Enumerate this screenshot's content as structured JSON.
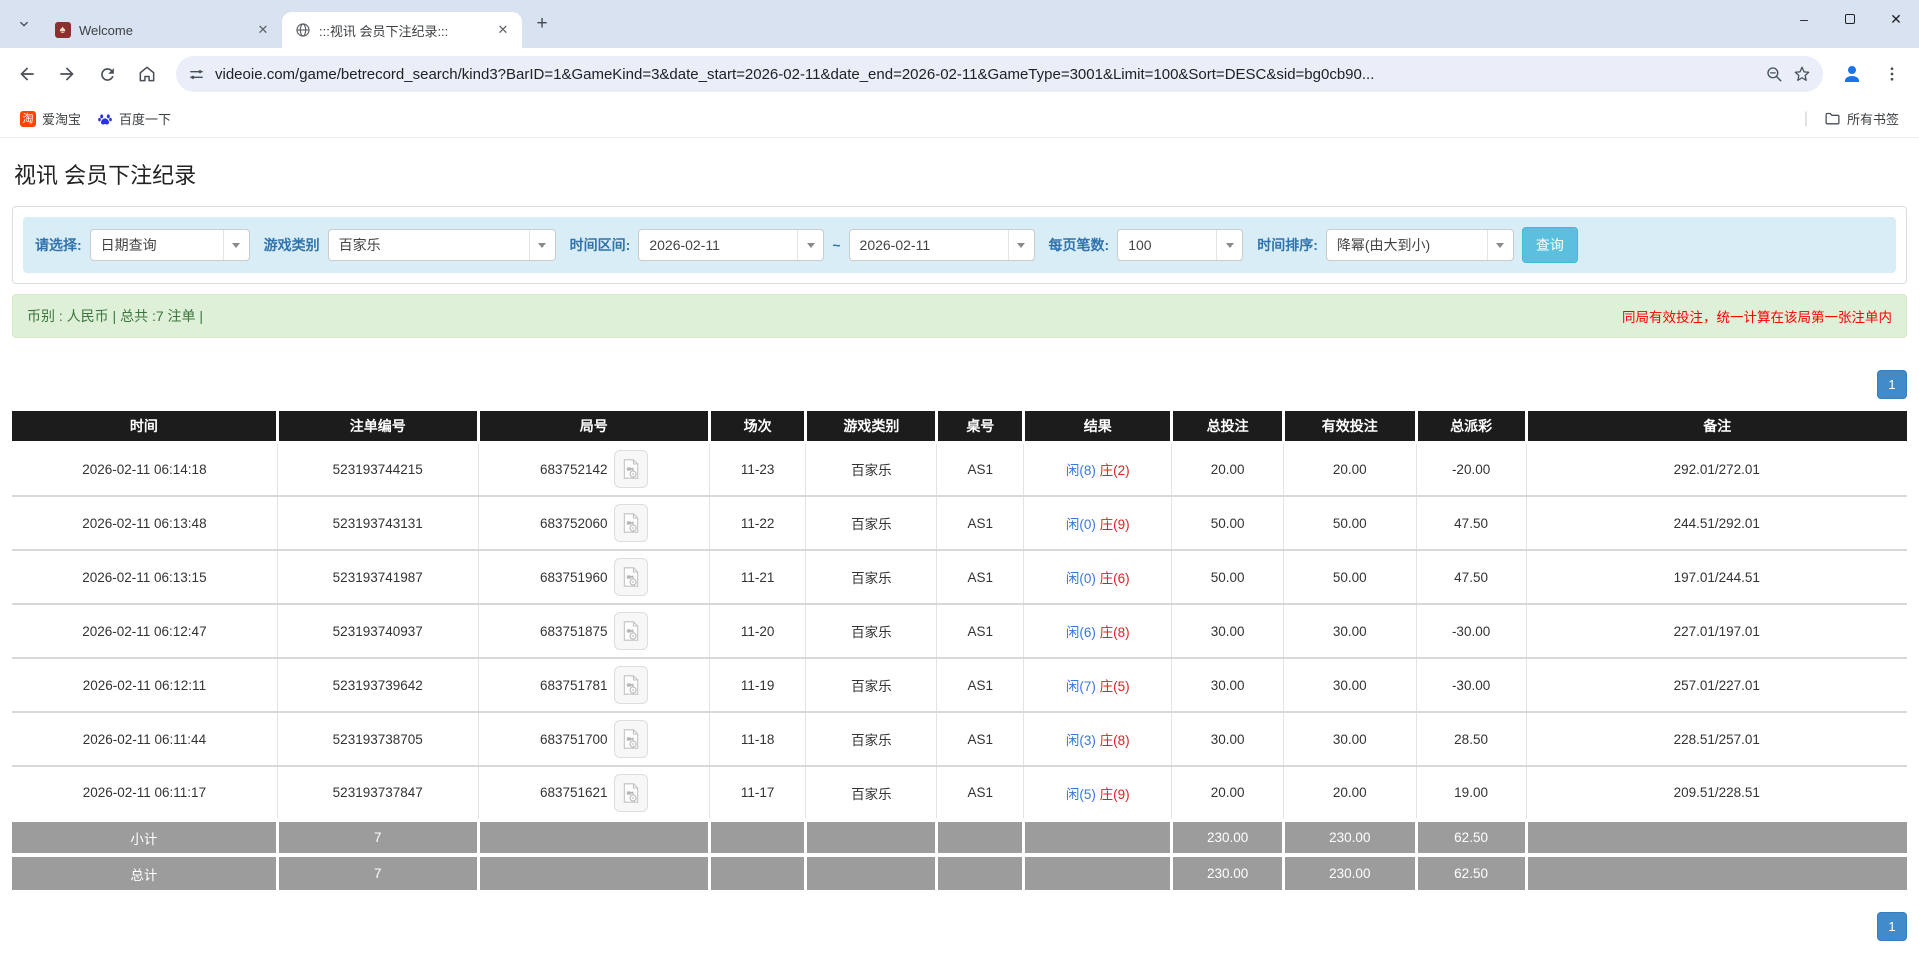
{
  "browser": {
    "tabs": [
      {
        "title": "Welcome",
        "active": false
      },
      {
        "title": ":::视讯 会员下注纪录:::",
        "active": true
      }
    ],
    "url": "videoie.com/game/betrecord_search/kind3?BarID=1&GameKind=3&date_start=2026-02-11&date_end=2026-02-11&GameType=3001&Limit=100&Sort=DESC&sid=bg0cb90...",
    "bookmarks": {
      "taobao": "爱淘宝",
      "baidu": "百度一下",
      "all_bookmarks": "所有书签"
    },
    "window_controls": {
      "minimize": "–",
      "close": "✕"
    },
    "new_tab": "+"
  },
  "page": {
    "title": "视讯 会员下注纪录",
    "filters": {
      "select_label": "请选择:",
      "select_value": "日期查询",
      "game_kind_label": "游戏类别",
      "game_kind_value": "百家乐",
      "date_range_label": "时间区间:",
      "date_start": "2026-02-11",
      "date_separator": "~",
      "date_end": "2026-02-11",
      "per_page_label": "每页笔数:",
      "per_page_value": "100",
      "sort_label": "时间排序:",
      "sort_value": "降幂(由大到小)",
      "search_button": "查询"
    },
    "summary": {
      "left": "币别 : 人民币 | 总共 :7 注单 |",
      "right": "同局有效投注，统一计算在该局第一张注单内"
    },
    "pagination": {
      "page_1": "1"
    }
  },
  "table": {
    "headers": [
      "时间",
      "注单编号",
      "局号",
      "场次",
      "游戏类别",
      "桌号",
      "结果",
      "总投注",
      "有效投注",
      "总派彩",
      "备注"
    ],
    "rows": [
      {
        "time": "2026-02-11 06:14:18",
        "bet_id": "523193744215",
        "round_id": "683752142",
        "session": "11-23",
        "game": "百家乐",
        "table_no": "AS1",
        "result_player": "闲(8)",
        "result_banker": "庄(2)",
        "total_bet": "20.00",
        "valid_bet": "20.00",
        "payout": "-20.00",
        "remark": "292.01/272.01"
      },
      {
        "time": "2026-02-11 06:13:48",
        "bet_id": "523193743131",
        "round_id": "683752060",
        "session": "11-22",
        "game": "百家乐",
        "table_no": "AS1",
        "result_player": "闲(0)",
        "result_banker": "庄(9)",
        "total_bet": "50.00",
        "valid_bet": "50.00",
        "payout": "47.50",
        "remark": "244.51/292.01"
      },
      {
        "time": "2026-02-11 06:13:15",
        "bet_id": "523193741987",
        "round_id": "683751960",
        "session": "11-21",
        "game": "百家乐",
        "table_no": "AS1",
        "result_player": "闲(0)",
        "result_banker": "庄(6)",
        "total_bet": "50.00",
        "valid_bet": "50.00",
        "payout": "47.50",
        "remark": "197.01/244.51"
      },
      {
        "time": "2026-02-11 06:12:47",
        "bet_id": "523193740937",
        "round_id": "683751875",
        "session": "11-20",
        "game": "百家乐",
        "table_no": "AS1",
        "result_player": "闲(6)",
        "result_banker": "庄(8)",
        "total_bet": "30.00",
        "valid_bet": "30.00",
        "payout": "-30.00",
        "remark": "227.01/197.01"
      },
      {
        "time": "2026-02-11 06:12:11",
        "bet_id": "523193739642",
        "round_id": "683751781",
        "session": "11-19",
        "game": "百家乐",
        "table_no": "AS1",
        "result_player": "闲(7)",
        "result_banker": "庄(5)",
        "total_bet": "30.00",
        "valid_bet": "30.00",
        "payout": "-30.00",
        "remark": "257.01/227.01"
      },
      {
        "time": "2026-02-11 06:11:44",
        "bet_id": "523193738705",
        "round_id": "683751700",
        "session": "11-18",
        "game": "百家乐",
        "table_no": "AS1",
        "result_player": "闲(3)",
        "result_banker": "庄(8)",
        "total_bet": "30.00",
        "valid_bet": "30.00",
        "payout": "28.50",
        "remark": "228.51/257.01"
      },
      {
        "time": "2026-02-11 06:11:17",
        "bet_id": "523193737847",
        "round_id": "683751621",
        "session": "11-17",
        "game": "百家乐",
        "table_no": "AS1",
        "result_player": "闲(5)",
        "result_banker": "庄(9)",
        "total_bet": "20.00",
        "valid_bet": "20.00",
        "payout": "19.00",
        "remark": "209.51/228.51"
      }
    ],
    "subtotal": {
      "label": "小计",
      "count": "7",
      "total_bet": "230.00",
      "valid_bet": "230.00",
      "payout": "62.50"
    },
    "total": {
      "label": "总计",
      "count": "7",
      "total_bet": "230.00",
      "valid_bet": "230.00",
      "payout": "62.50"
    }
  },
  "colors": {
    "tabstrip_bg": "#d9e2f1",
    "omnibox_bg": "#e9eef8",
    "filter_bar_bg": "#d9edf7",
    "filter_label": "#3173ad",
    "search_button_bg": "#5bc0de",
    "summary_bg": "#dff0d8",
    "summary_text": "#3c763d",
    "warning_text": "#ff0000",
    "table_header_bg": "#1c1c1c",
    "footer_row_bg": "#9c9c9c",
    "player_blue": "#3a75e0",
    "banker_red": "#e02020",
    "negative_red": "#ff0000",
    "pager_blue": "#428bca",
    "profile_blue": "#1a73e8"
  },
  "icons": {
    "tab_search": "chevron-down-icon",
    "tab1_favicon": "card-logo-icon",
    "tab2_favicon": "globe-icon",
    "nav": [
      "back-icon",
      "forward-icon",
      "reload-icon",
      "home-icon"
    ],
    "omnibox": [
      "site-settings-icon",
      "zoom-out-icon",
      "star-icon"
    ],
    "right": [
      "profile-icon",
      "kebab-menu-icon"
    ],
    "bookmarks": [
      "taobao-icon",
      "baidu-paw-icon",
      "folder-icon"
    ],
    "table": [
      "video-replay-icon"
    ]
  }
}
